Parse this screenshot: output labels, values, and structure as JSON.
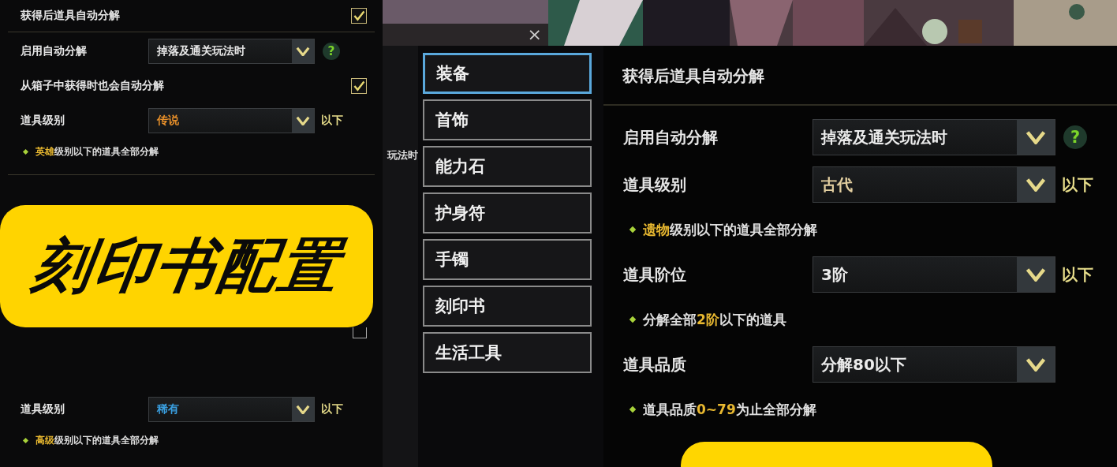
{
  "left_panel": {
    "top_rows": [
      {
        "kind": "toggle",
        "label": "获得后道具自动分解",
        "checked": true
      },
      {
        "kind": "select",
        "label": "启用自动分解",
        "value": "掉落及通关玩法时",
        "color": "#e8e8e8",
        "help": "?"
      },
      {
        "kind": "toggle",
        "label": "从箱子中获得时也会自动分解",
        "checked": true
      },
      {
        "kind": "select",
        "label": "道具级别",
        "value": "传说",
        "color": "#e8902a",
        "suffix": "以下"
      },
      {
        "kind": "note",
        "parts": [
          {
            "text": "英雄",
            "highlight": true
          },
          {
            "text": "级别以下的道具全部分解",
            "highlight": false
          }
        ]
      }
    ],
    "banner": "刻印书配置",
    "hidden_toggle": {
      "checked": false
    },
    "bottom_rows": [
      {
        "kind": "select",
        "label": "道具级别",
        "value": "稀有",
        "color": "#3a9fe0",
        "suffix": "以下"
      },
      {
        "kind": "note",
        "parts": [
          {
            "text": "高级",
            "highlight": true
          },
          {
            "text": "级别以下的道具全部分解",
            "highlight": false
          }
        ]
      }
    ]
  },
  "background_window": {
    "close": "×",
    "partial_text": "玩法时"
  },
  "menu": [
    {
      "label": "装备",
      "selected": true
    },
    {
      "label": "首饰",
      "selected": false
    },
    {
      "label": "能力石",
      "selected": false
    },
    {
      "label": "护身符",
      "selected": false
    },
    {
      "label": "手镯",
      "selected": false
    },
    {
      "label": "刻印书",
      "selected": false
    },
    {
      "label": "生活工具",
      "selected": false
    }
  ],
  "settings": {
    "title": "获得后道具自动分解",
    "rows": [
      {
        "kind": "select",
        "label": "启用自动分解",
        "value": "掉落及通关玩法时",
        "color": "#ececec",
        "help": "?"
      },
      {
        "kind": "select",
        "label": "道具级别",
        "value": "古代",
        "color": "#e3cfa0",
        "suffix": "以下"
      },
      {
        "kind": "note",
        "parts": [
          {
            "text": "遗物",
            "highlight": true
          },
          {
            "text": "级别以下的道具全部分解",
            "highlight": false
          }
        ]
      },
      {
        "kind": "select",
        "label": "道具阶位",
        "value": "3阶",
        "color": "#ececec",
        "suffix": "以下"
      },
      {
        "kind": "note",
        "parts": [
          {
            "text": "分解全部",
            "highlight": false
          },
          {
            "text": "2阶",
            "highlight": true
          },
          {
            "text": "以下的道具",
            "highlight": false
          }
        ]
      },
      {
        "kind": "select",
        "label": "道具品质",
        "value": "分解80以下",
        "color": "#ececec"
      },
      {
        "kind": "note",
        "parts": [
          {
            "text": "道具品质",
            "highlight": false
          },
          {
            "text": "0~79",
            "highlight": true
          },
          {
            "text": "为止全部分解",
            "highlight": false
          }
        ]
      }
    ]
  }
}
